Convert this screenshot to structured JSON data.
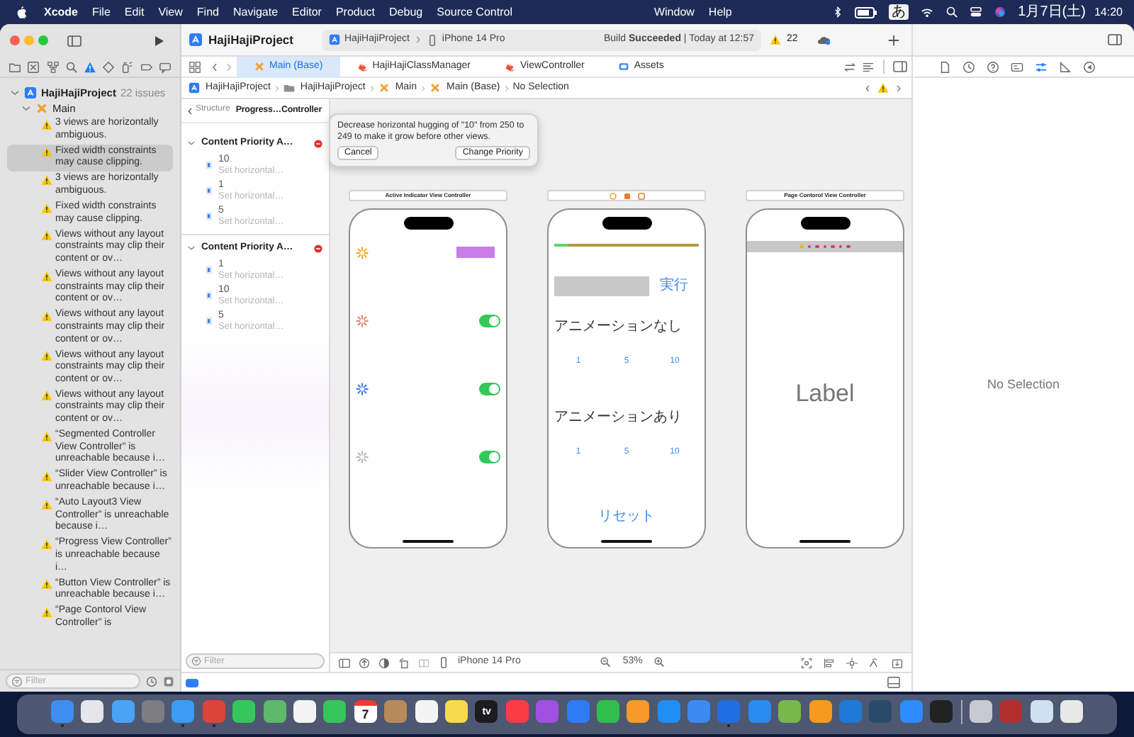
{
  "menubar": {
    "app": "Xcode",
    "menus": [
      "File",
      "Edit",
      "View",
      "Find",
      "Navigate",
      "Editor",
      "Product",
      "Debug",
      "Source Control"
    ],
    "menus_right": [
      "Window",
      "Help"
    ],
    "input_mode": "あ",
    "date": "1月7日(土)",
    "time": "14:20"
  },
  "toolbar": {
    "project": "HajiHajiProject",
    "scheme": "HajiHajiProject",
    "device": "iPhone 14 Pro",
    "build_status": "Build **Succeeded** | Today at 12:57",
    "warnings": "22"
  },
  "navigator_tabs": [
    {
      "kind": "folder",
      "selected": false
    },
    {
      "kind": "source",
      "selected": false
    },
    {
      "kind": "symbol",
      "selected": false
    },
    {
      "kind": "find",
      "selected": false
    },
    {
      "kind": "issue",
      "selected": true
    },
    {
      "kind": "test",
      "selected": false
    },
    {
      "kind": "debug",
      "selected": false
    },
    {
      "kind": "breakpoint",
      "selected": false
    },
    {
      "kind": "report",
      "selected": false
    }
  ],
  "navigator": {
    "project": "HajiHajiProject",
    "project_expanded": true,
    "issue_count": "22 issues",
    "group": "Main",
    "expanded": true,
    "filter_placeholder": "Filter",
    "issues": [
      {
        "text": "3 views are horizontally ambiguous.",
        "selected": false
      },
      {
        "text": "Fixed width constraints may cause clipping.",
        "selected": true
      },
      {
        "text": "3 views are horizontally ambiguous.",
        "selected": false
      },
      {
        "text": "Fixed width constraints may cause clipping.",
        "selected": false
      },
      {
        "text": "Views without any layout constraints may clip their content or ov…",
        "selected": false
      },
      {
        "text": "Views without any layout constraints may clip their content or ov…",
        "selected": false
      },
      {
        "text": "Views without any layout constraints may clip their content or ov…",
        "selected": false
      },
      {
        "text": "Views without any layout constraints may clip their content or ov…",
        "selected": false
      },
      {
        "text": "Views without any layout constraints may clip their content or ov…",
        "selected": false
      },
      {
        "text": "“Segmented Controller View Controller” is unreachable because i…",
        "selected": false
      },
      {
        "text": "“Slider View Controller” is unreachable because i…",
        "selected": false
      },
      {
        "text": "“Auto Layout3 View Controller” is unreachable because i…",
        "selected": false
      },
      {
        "text": "“Progress View Controller” is unreachable because i…",
        "selected": false
      },
      {
        "text": "“Button View Controller” is unreachable because i…",
        "selected": false
      },
      {
        "text": "“Page Contorol View Controller” is",
        "selected": false
      }
    ]
  },
  "tabs": [
    {
      "label": "Main (Base)",
      "kind": "storyboard",
      "selected": true
    },
    {
      "label": "HajiHajiClassManager",
      "kind": "swift",
      "selected": false
    },
    {
      "label": "ViewController",
      "kind": "swift",
      "selected": false
    },
    {
      "label": "Assets",
      "kind": "assets",
      "selected": false
    }
  ],
  "jump_bar": [
    {
      "label": "HajiHajiProject",
      "kind": "project"
    },
    {
      "label": "HajiHajiProject",
      "kind": "folder"
    },
    {
      "label": "Main",
      "kind": "storyboard"
    },
    {
      "label": "Main (Base)",
      "kind": "storyboard"
    },
    {
      "label": "No Selection",
      "kind": "none"
    }
  ],
  "outline": {
    "back": "Structure",
    "title": "Progress…Controller",
    "filter_placeholder": "Filter",
    "groups": [
      {
        "title": "Content Priority A…",
        "expanded": true,
        "items": [
          {
            "value": "10",
            "hint": "Set horizontal…"
          },
          {
            "value": "1",
            "hint": "Set horizontal…"
          },
          {
            "value": "5",
            "hint": "Set horizontal…"
          }
        ]
      },
      {
        "title": "Content Priority A…",
        "expanded": true,
        "items": [
          {
            "value": "1",
            "hint": "Set horizontal…"
          },
          {
            "value": "10",
            "hint": "Set horizontal…"
          },
          {
            "value": "5",
            "hint": "Set horizontal…"
          }
        ]
      }
    ]
  },
  "popover": {
    "message": "Decrease horizontal hugging of \"10\" from 250 to 249 to make it grow before other views.",
    "buttons": [
      "Cancel",
      "Change Priority"
    ]
  },
  "scenes": [
    {
      "kind": "indicators",
      "title": "Active Indicator View Controller",
      "rows": [
        {
          "kind": "button",
          "color": "#f5a623"
        },
        {
          "kind": "switch",
          "color": "#e8806a",
          "on": true
        },
        {
          "kind": "switch",
          "color": "#3a7bf0",
          "on": true
        },
        {
          "kind": "switch",
          "color": "#b8b8b8",
          "on": true
        }
      ]
    },
    {
      "kind": "progress",
      "progress": {
        "level": 0.1
      },
      "run_button": "実行",
      "sections": [
        {
          "label": "アニメーションなし",
          "buttons": [
            "1",
            "5",
            "10"
          ]
        },
        {
          "label": "アニメーションあり",
          "buttons": [
            "1",
            "5",
            "10"
          ]
        }
      ],
      "reset_button": "リセット"
    },
    {
      "kind": "page_control",
      "title": "Page Contorol View Controller",
      "dots": [
        {
          "selected": true
        },
        {
          "selected": false
        },
        {
          "selected": false
        },
        {
          "selected": false
        },
        {
          "selected": false
        },
        {
          "selected": false
        },
        {
          "selected": false
        }
      ],
      "label": "Label"
    }
  ],
  "canvas_bar": {
    "device": "iPhone 14 Pro",
    "zoom": "53%"
  },
  "inspector": {
    "tabs": [
      {
        "kind": "file",
        "selected": false
      },
      {
        "kind": "history",
        "selected": false
      },
      {
        "kind": "help",
        "selected": false
      },
      {
        "kind": "identity",
        "selected": false
      },
      {
        "kind": "attributes",
        "selected": true
      },
      {
        "kind": "size",
        "selected": false
      },
      {
        "kind": "connections",
        "selected": false
      }
    ],
    "empty_text": "No Selection"
  },
  "dock": {
    "apps": [
      {
        "color": "#3d8ef0",
        "running": true
      },
      {
        "color": "#e6e6ea",
        "running": false
      },
      {
        "color": "#4aa3f5",
        "running": false
      },
      {
        "color": "#7d7d82",
        "running": false
      },
      {
        "color": "#3a9cf5",
        "running": true
      },
      {
        "color": "#db4437",
        "running": true
      },
      {
        "color": "#35c759",
        "running": false
      },
      {
        "color": "#5fb96b",
        "running": false
      },
      {
        "color": "#f4f4f4",
        "running": false
      },
      {
        "color": "#34c65a",
        "running": false
      },
      {
        "color": "#ffffff",
        "running": false,
        "label": "7"
      },
      {
        "color": "#b88a5a",
        "running": false
      },
      {
        "color": "#f4f4f4",
        "running": false
      },
      {
        "color": "#f8d94a",
        "running": false
      },
      {
        "color": "#1c1c1e",
        "running": false,
        "label": "tv"
      },
      {
        "color": "#fc3c44",
        "running": false
      },
      {
        "color": "#a050e0",
        "running": false
      },
      {
        "color": "#2f7bf5",
        "running": false
      },
      {
        "color": "#2fbf4a",
        "running": false
      },
      {
        "color": "#f79a2a",
        "running": false
      },
      {
        "color": "#1e8ef5",
        "running": false
      },
      {
        "color": "#3a8af0",
        "running": false
      },
      {
        "color": "#1f6fe0",
        "running": true
      },
      {
        "color": "#2a8cf0",
        "running": false
      },
      {
        "color": "#78b84a",
        "running": false
      },
      {
        "color": "#f59a1f",
        "running": false
      },
      {
        "color": "#1e7ad4",
        "running": false
      },
      {
        "color": "#2a4a6a",
        "running": false
      },
      {
        "color": "#2d8cff",
        "running": false
      },
      {
        "color": "#222222",
        "running": false
      }
    ],
    "others": [
      {
        "color": "#c8c8d0",
        "running": false
      },
      {
        "color": "#b03030",
        "running": false
      },
      {
        "color": "#cfe0f0",
        "running": false
      },
      {
        "color": "#e8e8e8",
        "running": false
      }
    ]
  }
}
